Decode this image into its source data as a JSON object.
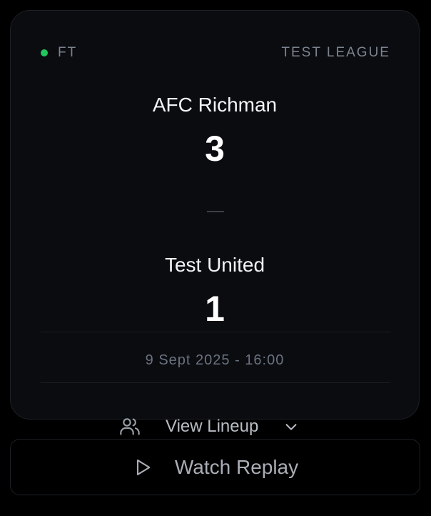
{
  "match": {
    "status": "FT",
    "league": "TEST LEAGUE",
    "home_team": "AFC Richman",
    "home_score": "3",
    "away_team": "Test United",
    "away_score": "1",
    "datetime": "9 Sept 2025 - 16:00"
  },
  "actions": {
    "lineup_label": "View Lineup",
    "replay_label": "Watch Replay"
  },
  "icons": {
    "status": "live-dot",
    "lineup": "users-icon",
    "expand": "chevron-down-icon",
    "replay": "play-icon"
  },
  "colors": {
    "status_dot": "#22c55e",
    "card_bg": "#0a0c10",
    "page_bg": "#000000",
    "muted_text": "#7c8390"
  }
}
